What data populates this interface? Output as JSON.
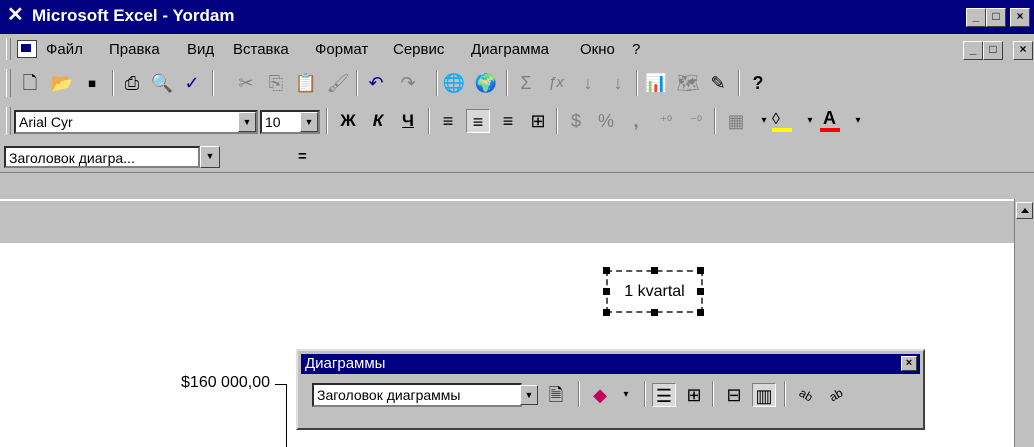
{
  "window": {
    "title": "Microsoft Excel - Yordam",
    "app_icon": "excel-icon",
    "minimize": "_",
    "restore": "□",
    "close": "×"
  },
  "menu": {
    "items": [
      "Файл",
      "Правка",
      "Вид",
      "Вставка",
      "Формат",
      "Сервис",
      "Диаграмма",
      "Окно",
      "?"
    ],
    "doc_minimize": "_",
    "doc_restore": "□",
    "doc_close": "×"
  },
  "standard_toolbar": {
    "icons": [
      "new-icon",
      "open-icon",
      "save-icon",
      "print-icon",
      "print-preview-icon",
      "spelling-icon",
      "cut-icon",
      "copy-icon",
      "paste-icon",
      "format-painter-icon",
      "undo-icon",
      "redo-icon",
      "web-icon",
      "hyperlink-icon",
      "autosum-icon",
      "function-icon",
      "sort-ascending-icon",
      "sort-descending-icon",
      "chart-wizard-icon",
      "map-icon",
      "drawing-icon",
      "help-icon"
    ],
    "glyphs": {
      "new": "🗋",
      "open": "📂",
      "save": "▪",
      "print": "⎙",
      "preview": "🔍",
      "spell": "✓",
      "cut": "✂",
      "copy": "⎘",
      "paste": "📋",
      "painter": "🖌",
      "undo": "↶",
      "redo": "↷",
      "web": "🌐",
      "hyperlink": "🌍",
      "sum": "Σ",
      "fx": "ƒx",
      "sort_az": "↓",
      "sort_za": "↓",
      "chart": "📊",
      "map": "🗺",
      "draw": "✎",
      "help": "?"
    }
  },
  "formatting_toolbar": {
    "font": "Arial Cyr",
    "size": "10",
    "bold": "Ж",
    "italic": "К",
    "underline": "Ч",
    "percent": "%",
    "comma": ",",
    "inc_decimal": "⁺⁰",
    "dec_decimal": "⁻⁰",
    "font_color_letter": "A",
    "colors": {
      "fill": "#ffff00",
      "font": "#ff0000"
    }
  },
  "formula_bar": {
    "name_box": "Заголовок диагра...",
    "equals": "="
  },
  "chart": {
    "title": "1 kvartal",
    "axis_label": "$160 000,00"
  },
  "charts_toolbar": {
    "title": "Диаграммы",
    "close": "×",
    "object_select": "Заголовок диаграммы",
    "icons": [
      "format-object-icon",
      "chart-type-icon",
      "legend-icon",
      "data-table-icon",
      "by-row-icon",
      "by-column-icon",
      "angle-text-down-icon",
      "angle-text-up-icon"
    ],
    "glyphs": {
      "format": "🗎",
      "chart_type": "◆",
      "legend": "☰",
      "data_table": "⊞",
      "by_row": "⊟",
      "by_column": "▥",
      "angle_down": "ab",
      "angle_up": "ab"
    }
  },
  "colors": {
    "titlebar": "#000080",
    "face": "#c0c0c0"
  }
}
